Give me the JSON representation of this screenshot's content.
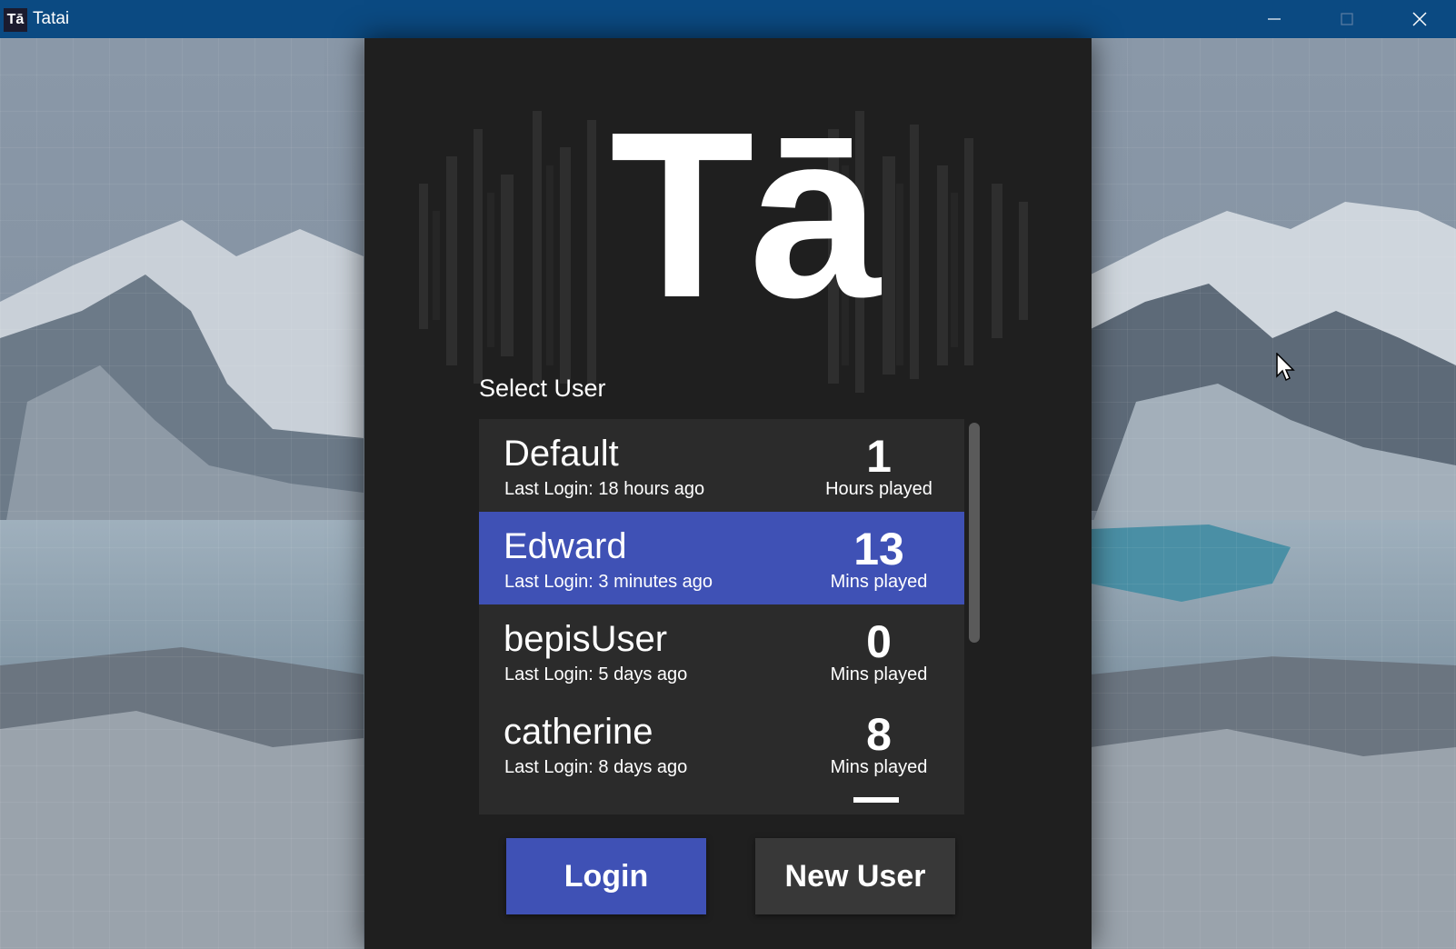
{
  "window": {
    "app_icon_text": "Tā",
    "title": "Tatai"
  },
  "logo": {
    "text": "Tā"
  },
  "select_label": "Select User",
  "users": [
    {
      "name": "Default",
      "last_login": "Last Login: 18 hours ago",
      "stat_value": "1",
      "stat_label": "Hours played",
      "selected": false
    },
    {
      "name": "Edward",
      "last_login": "Last Login: 3 minutes ago",
      "stat_value": "13",
      "stat_label": "Mins played",
      "selected": true
    },
    {
      "name": "bepisUser",
      "last_login": "Last Login: 5 days ago",
      "stat_value": "0",
      "stat_label": "Mins played",
      "selected": false
    },
    {
      "name": "catherine",
      "last_login": "Last Login: 8 days ago",
      "stat_value": "8",
      "stat_label": "Mins played",
      "selected": false
    }
  ],
  "buttons": {
    "login": "Login",
    "new_user": "New User"
  },
  "colors": {
    "accent": "#3f51b5",
    "title_bar": "#0b4a82",
    "panel": "#1f1f1f",
    "list": "#2b2b2b"
  }
}
